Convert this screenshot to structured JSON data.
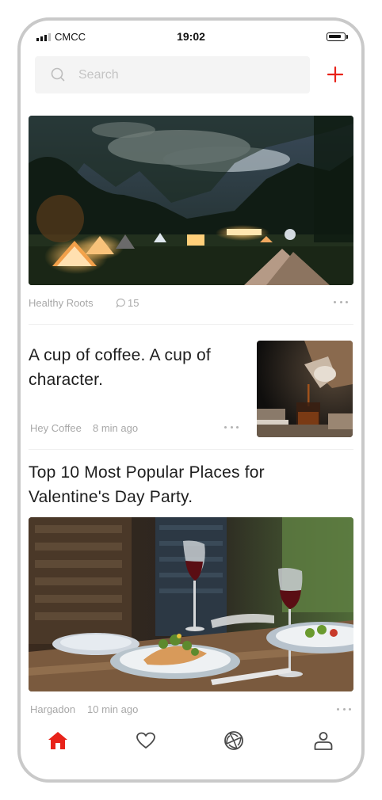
{
  "status_bar": {
    "carrier": "CMCC",
    "time": "19:02"
  },
  "search": {
    "placeholder": "Search"
  },
  "feed": [
    {
      "source": "Healthy Roots",
      "comments": "15",
      "image": "night camping tents photo"
    },
    {
      "title": "A cup of coffee. A cup of character.",
      "source": "Hey Coffee",
      "time": "8 min ago",
      "image": "pouring coffee photo"
    },
    {
      "title": "Top 10 Most Popular Places for Valentine's Day Party.",
      "source": "Hargadon",
      "time": "10 min ago",
      "image": "dinner table with wine photo"
    }
  ],
  "colors": {
    "accent": "#e8231a",
    "muted_text": "#a8a8a8",
    "search_bg": "#f4f4f4"
  },
  "tab_bar": [
    {
      "icon": "home-icon",
      "active": true
    },
    {
      "icon": "heart-icon",
      "active": false
    },
    {
      "icon": "aperture-icon",
      "active": false
    },
    {
      "icon": "user-icon",
      "active": false
    }
  ]
}
